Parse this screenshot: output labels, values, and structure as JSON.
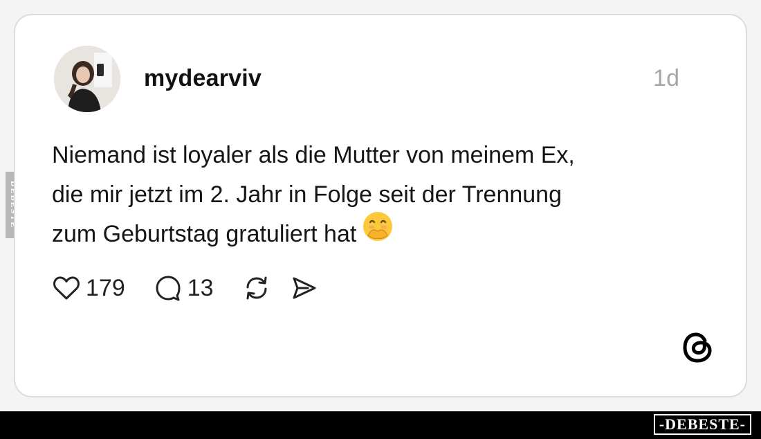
{
  "post": {
    "username": "mydearviv",
    "time": "1d",
    "text_lines": [
      "Niemand ist loyaler als die Mutter von meinem Ex,",
      "die mir jetzt im 2. Jahr in Folge seit der Trennung",
      "zum Geburtstag gratuliert hat"
    ],
    "emoji_icon": "hand-over-mouth-emoji-icon"
  },
  "actions": {
    "likes": "179",
    "replies": "13",
    "repost_icon": "repost-icon",
    "share_icon": "send-icon"
  },
  "brand": {
    "app_logo": "threads-logo-icon",
    "watermark_side": "DEBESTE",
    "watermark_footer": "-DEBESTE-"
  },
  "colors": {
    "card_bg": "#ffffff",
    "text": "#151515",
    "muted": "#a6a6a6",
    "footer_bg": "#000000"
  }
}
